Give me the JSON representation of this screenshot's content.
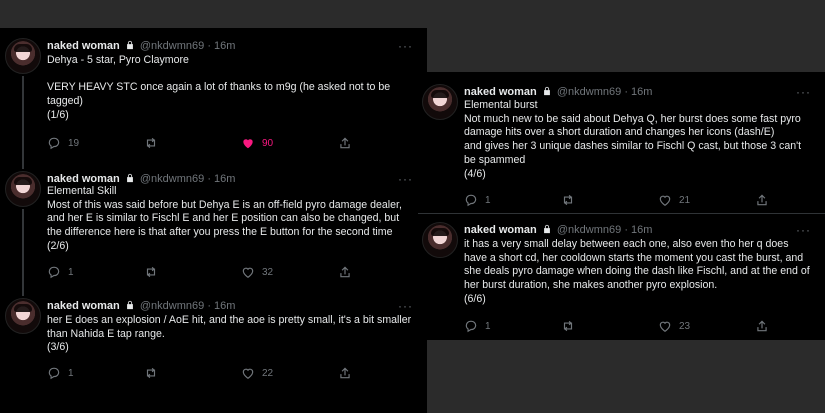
{
  "author": {
    "name": "naked woman",
    "handle": "@nkdwmn69",
    "dot": "·",
    "time": "16m"
  },
  "more_label": "···",
  "tweets": [
    {
      "id": "t1",
      "text": "Dehya - 5 star, Pyro Claymore\n\nVERY HEAVY STC once again a lot of thanks to m9g (he asked not to be tagged)\n(1/6)",
      "replies": "19",
      "retweets": "",
      "likes": "90",
      "liked": true
    },
    {
      "id": "t2",
      "text": "Elemental Skill\nMost of this was said before but Dehya E is an off-field pyro damage dealer, and her E is similar to Fischl E and her E position can also be changed, but the difference here is that after you press the E button for the second time\n(2/6)",
      "replies": "1",
      "retweets": "",
      "likes": "32",
      "liked": false
    },
    {
      "id": "t3",
      "text": "her E does an explosion / AoE hit, and the aoe is pretty small, it's a bit smaller than Nahida E tap range.\n(3/6)",
      "replies": "1",
      "retweets": "",
      "likes": "22",
      "liked": false
    },
    {
      "id": "t4",
      "text": "Elemental burst\nNot much new to be said about Dehya Q, her burst does some fast pyro damage hits over a short duration and changes her icons (dash/E)\nand gives her 3 unique dashes similar to Fischl Q cast, but those 3 can't be spammed\n(4/6)",
      "replies": "1",
      "retweets": "",
      "likes": "21",
      "liked": false
    },
    {
      "id": "t5",
      "text": "it has a very small delay between each one, also even tho her q does have a short cd, her cooldown starts the moment you cast the burst, and she deals pyro damage when doing the dash like Fischl, and at the end of her burst duration, she makes another pyro explosion.\n(6/6)",
      "replies": "1",
      "retweets": "",
      "likes": "23",
      "liked": false
    }
  ],
  "colors": {
    "background": "#000000",
    "text": "#e7e9ea",
    "muted": "#71767b",
    "like": "#f91880",
    "divider": "#2f3336"
  }
}
